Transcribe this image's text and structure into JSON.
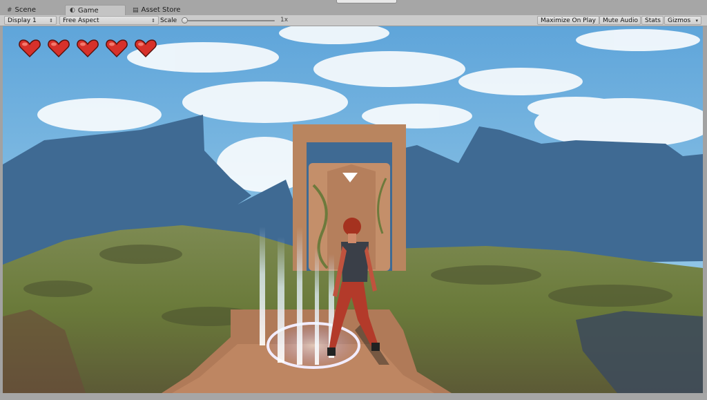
{
  "tabs": [
    {
      "label": "Scene",
      "icon": "grid-icon"
    },
    {
      "label": "Game",
      "icon": "pacman-icon"
    },
    {
      "label": "Asset Store",
      "icon": "store-icon"
    }
  ],
  "toolbar": {
    "display_label": "Display 1",
    "aspect_label": "Free Aspect",
    "scale_label": "Scale",
    "scale_value": "1x",
    "scale_fraction": 0.0,
    "maximize_label": "Maximize On Play",
    "mute_label": "Mute Audio",
    "stats_label": "Stats",
    "gizmos_label": "Gizmos"
  },
  "hud": {
    "hearts_total": 5,
    "hearts_full": 5,
    "heart_color": "#d7312a"
  }
}
